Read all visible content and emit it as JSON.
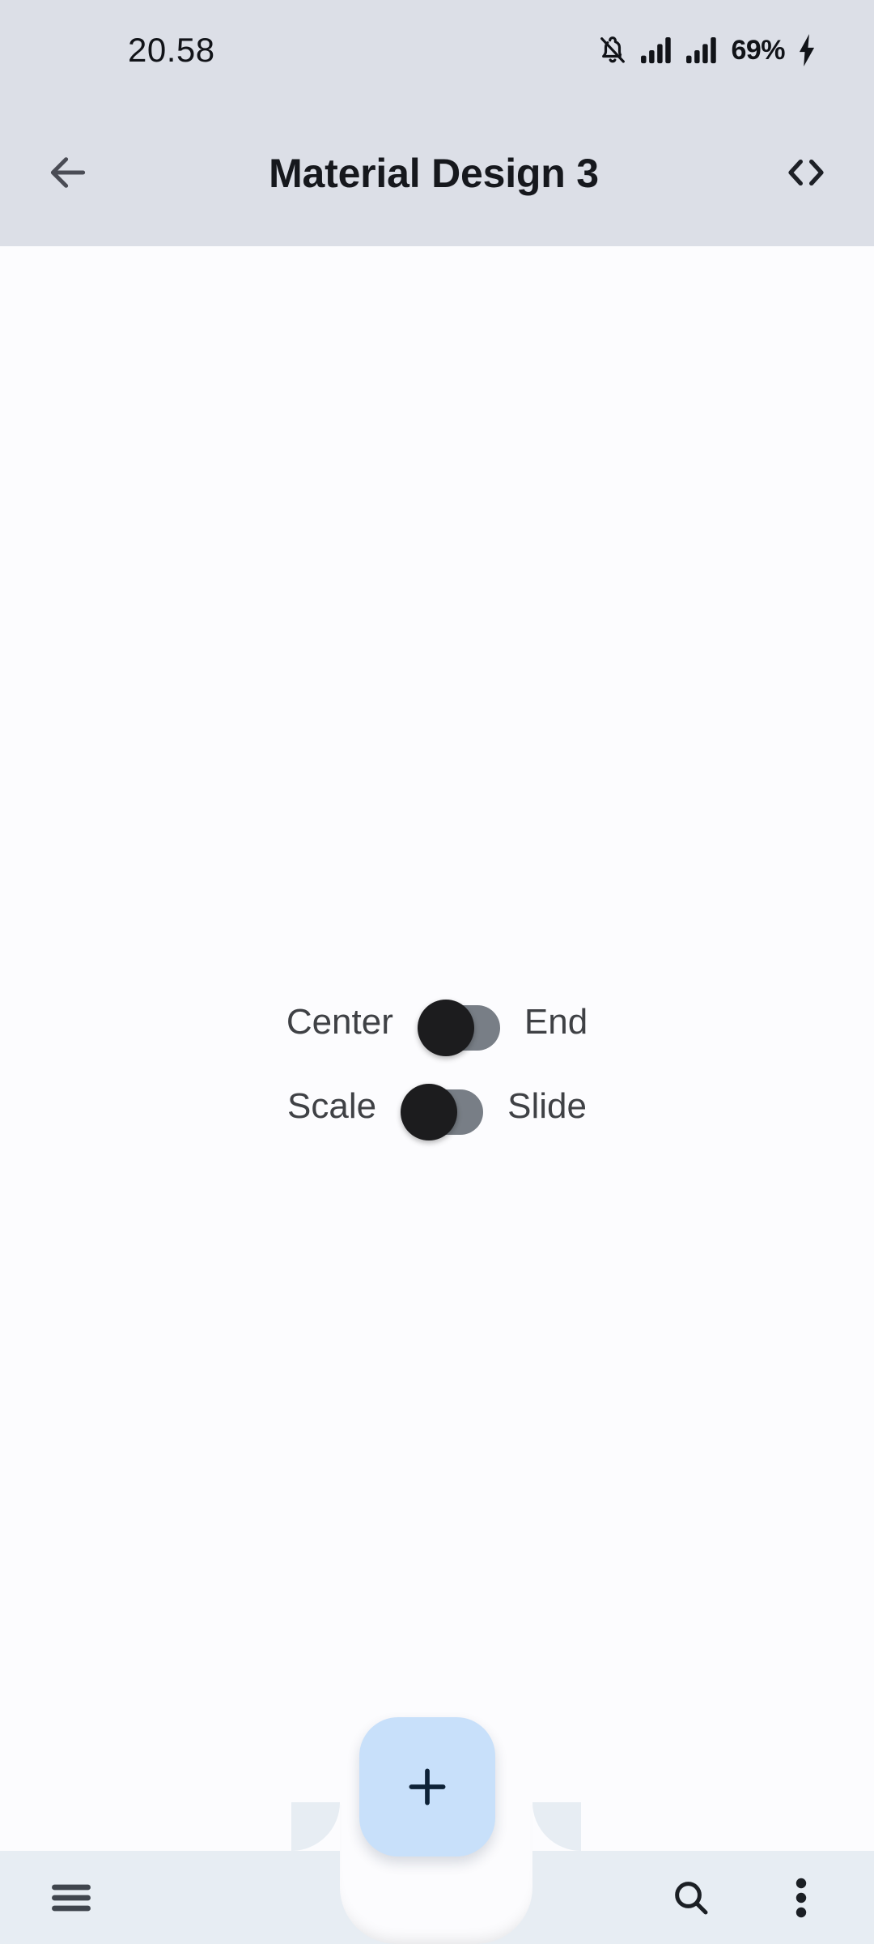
{
  "status_bar": {
    "time": "20.58",
    "battery_percent": "69%",
    "icons": [
      "bell-off-icon",
      "signal-icon",
      "signal-icon",
      "charging-bolt-icon"
    ]
  },
  "app_bar": {
    "title": "Material Design 3",
    "back_icon": "back-arrow-icon",
    "code_icon": "code-brackets-icon"
  },
  "content": {
    "switches": [
      {
        "left_label": "Center",
        "right_label": "End",
        "state": "off",
        "thumb_color": "#1c1c1e",
        "track_color": "#787e86"
      },
      {
        "left_label": "Scale",
        "right_label": "Slide",
        "state": "off",
        "thumb_color": "#1c1c1e",
        "track_color": "#787e86"
      }
    ]
  },
  "fab": {
    "icon": "plus-icon",
    "background": "#c8e0fa",
    "icon_color": "#0d2237"
  },
  "bottom_bar": {
    "background": "#e7edf3",
    "left_items": [
      {
        "icon": "menu-hamburger-icon"
      }
    ],
    "right_items": [
      {
        "icon": "search-icon"
      },
      {
        "icon": "more-vert-icon"
      }
    ]
  },
  "colors": {
    "app_bar_background": "#dcdfe7",
    "content_background": "#fcfcfe",
    "title_text": "#16181d",
    "label_text": "#3f4145"
  }
}
